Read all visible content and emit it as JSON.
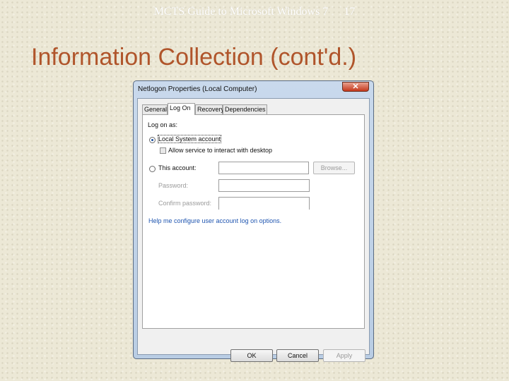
{
  "slide": {
    "header": "MCTS Guide to Microsoft Windows 7",
    "page_number": "17",
    "title": "Information Collection (cont'd.)"
  },
  "dialog": {
    "title": "Netlogon Properties (Local Computer)",
    "close_glyph": "✕",
    "tabs": [
      {
        "label": "General"
      },
      {
        "label": "Log On"
      },
      {
        "label": "Recovery"
      },
      {
        "label": "Dependencies"
      }
    ],
    "active_tab": "Log On",
    "logon": {
      "group_label": "Log on as:",
      "local_system_label": "Local System account",
      "allow_desktop_label": "Allow service to interact with desktop",
      "this_account_label": "This account:",
      "this_account_value": "",
      "browse_label": "Browse...",
      "password_label": "Password:",
      "password_value": "",
      "confirm_label": "Confirm password:",
      "confirm_value": "",
      "help_link": "Help me configure user account log on options."
    },
    "buttons": {
      "ok": "OK",
      "cancel": "Cancel",
      "apply": "Apply"
    },
    "colors": {
      "accent_link": "#1f55b0",
      "title_text": "#b0552b"
    }
  }
}
